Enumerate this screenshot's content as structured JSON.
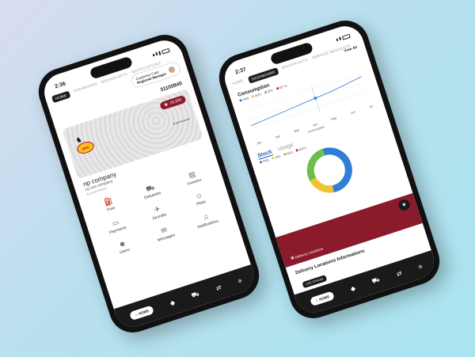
{
  "left_phone": {
    "time": "2:36",
    "tabs": [
      "HOME",
      "DASHBOARD",
      "BROADCASTS",
      "NOTIFICATIONS"
    ],
    "active_tab": "HOME",
    "profile": {
      "name": "Customer Care",
      "role": "Regional Manager"
    },
    "account_number": "31100840",
    "balance": "16,200",
    "masked_number": "********",
    "company": {
      "title": "np company",
      "subtitle": "np oos company",
      "note": "Account Admin"
    },
    "menu": [
      {
        "label": "Fuel",
        "icon": "fuel-pump-icon"
      },
      {
        "label": "Deliveries",
        "icon": "truck-icon"
      },
      {
        "label": "Invoices",
        "icon": "invoice-icon"
      },
      {
        "label": "Payments",
        "icon": "payment-icon"
      },
      {
        "label": "Aircrafts",
        "icon": "airplane-icon"
      },
      {
        "label": "Pilots",
        "icon": "pilot-icon"
      },
      {
        "label": "Users",
        "icon": "users-icon"
      },
      {
        "label": "Messages",
        "icon": "message-icon"
      },
      {
        "label": "Notifications",
        "icon": "bell-icon"
      }
    ],
    "bottom_nav": {
      "home_label": "HOME"
    }
  },
  "right_phone": {
    "time": "2:37",
    "tabs": [
      "HOME",
      "DASHBOARD",
      "BROADCASTS",
      "SERVICE REQUESTS"
    ],
    "active_tab": "DASHBOARD",
    "view_all": "View All",
    "consumption_title": "Consumption",
    "consumption_legend": [
      "PMS",
      "AGO",
      "DPK",
      "JET A"
    ],
    "consumption_axis": [
      "Jan",
      "Feb",
      "Mar",
      "Apr",
      "May",
      "Jun",
      "Jul"
    ],
    "consumption_footer": "Consumption",
    "stock_tab": "Stock",
    "usage_tab": "Usage",
    "stock_legend": [
      "PMS",
      "JAG",
      "AGO",
      "AVGT"
    ],
    "delivery_locations_label": "Delivery Locations",
    "delivery_info_title": "Delivery Locations Informations",
    "mini_chip": "LIVE STOCKS",
    "bottom_nav": {
      "home_label": "HOME"
    }
  },
  "colors": {
    "brand_red": "#8b1a2b",
    "donut_blue": "#2f7fd6",
    "donut_yellow": "#f2c233",
    "donut_green": "#6cbf4a",
    "donut_red": "#c8102e"
  },
  "chart_data": {
    "type": "pie",
    "title": "Stock",
    "categories": [
      "PMS",
      "JAG",
      "AGO",
      "AVGT"
    ],
    "values": [
      52,
      20,
      28,
      0
    ],
    "legend": "top"
  }
}
